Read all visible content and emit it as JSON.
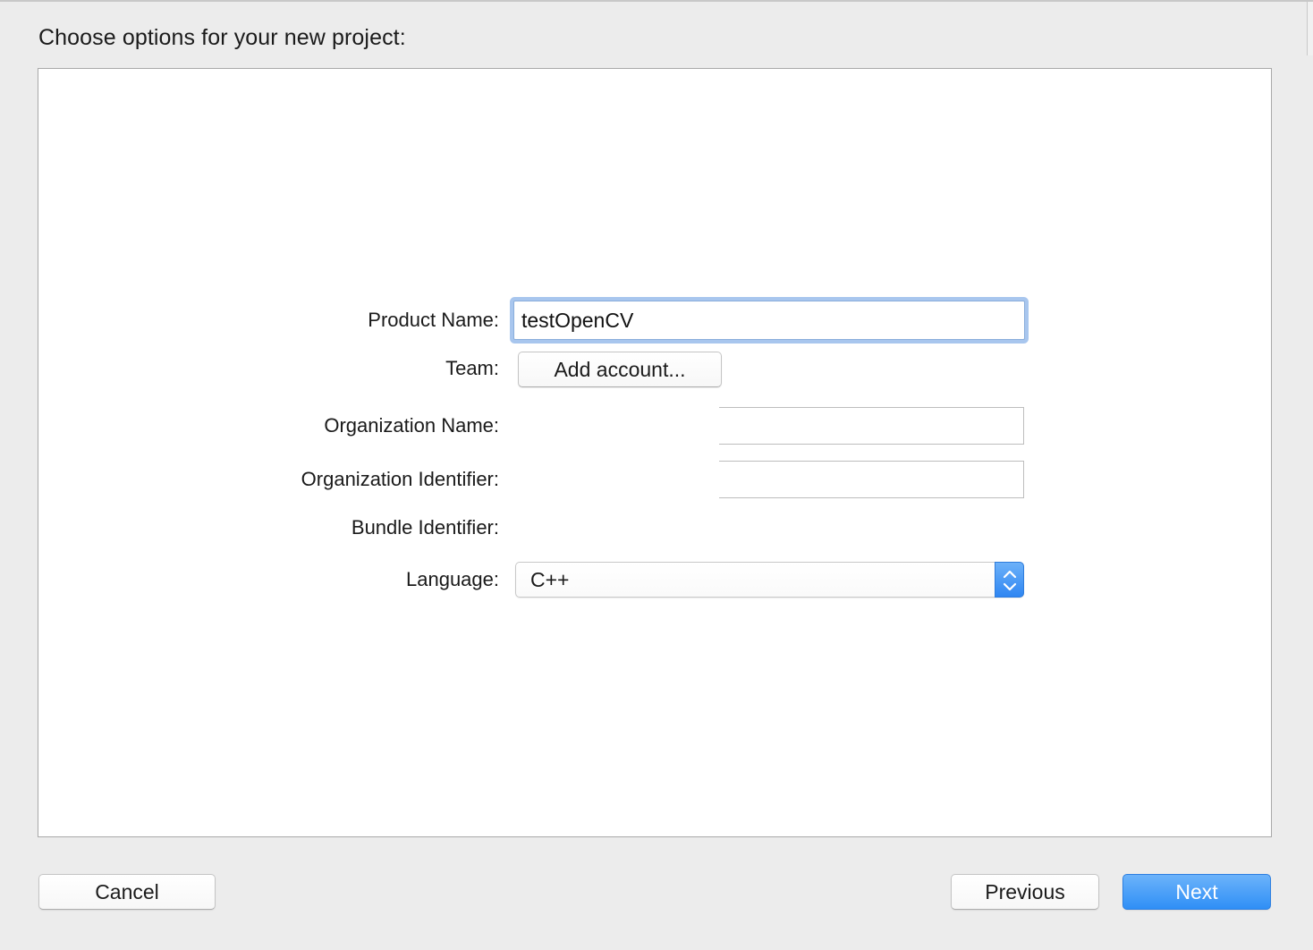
{
  "dialog": {
    "title": "Choose options for your new project:"
  },
  "form": {
    "product_name_label": "Product Name:",
    "product_name_value": "testOpenCV",
    "team_label": "Team:",
    "team_button_label": "Add account...",
    "organization_name_label": "Organization Name:",
    "organization_name_value": "",
    "organization_identifier_label": "Organization Identifier:",
    "organization_identifier_value": "",
    "bundle_identifier_label": "Bundle Identifier:",
    "language_label": "Language:",
    "language_value": "C++"
  },
  "footer": {
    "cancel_label": "Cancel",
    "previous_label": "Previous",
    "next_label": "Next"
  },
  "colors": {
    "accent": "#3b93f7",
    "focus_ring": "#a8c6ee"
  },
  "icons": {
    "language_stepper": "up-down-chevron-icon"
  }
}
